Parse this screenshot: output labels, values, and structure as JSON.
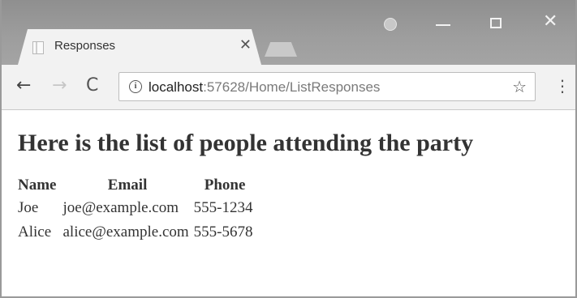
{
  "browser": {
    "tab": {
      "title": "Responses",
      "close_glyph": "✕"
    },
    "window_controls": {
      "profile_icon": "profile-icon",
      "minimize_icon": "minimize-icon",
      "maximize_icon": "maximize-icon",
      "close_glyph": "✕"
    },
    "toolbar": {
      "back_glyph": "←",
      "forward_glyph": "→",
      "reload_glyph": "C",
      "info_glyph": "i",
      "url_host": "localhost",
      "url_rest": ":57628/Home/ListResponses",
      "star_glyph": "☆",
      "menu_glyph": "⋮"
    }
  },
  "page": {
    "heading": "Here is the list of people attending the party",
    "table": {
      "headers": [
        "Name",
        "Email",
        "Phone"
      ],
      "rows": [
        [
          "Joe",
          "joe@example.com",
          "555-1234"
        ],
        [
          "Alice",
          "alice@example.com",
          "555-5678"
        ]
      ]
    }
  }
}
